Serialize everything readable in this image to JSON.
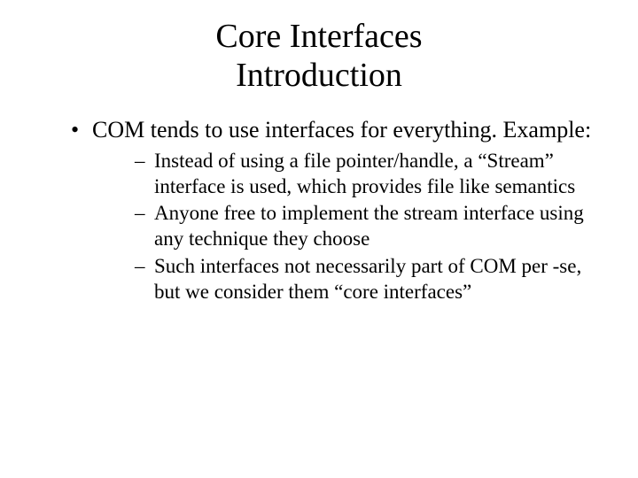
{
  "title_line1": "Core Interfaces",
  "title_line2": "Introduction",
  "bullets": [
    {
      "text": "COM tends to use interfaces for everything. Example:",
      "subs": [
        "Instead of using a file pointer/handle, a “Stream” interface is used, which provides file like semantics",
        "Anyone free to implement the stream interface using any technique they choose",
        "Such interfaces not necessarily part of COM per -se, but we consider them “core interfaces”"
      ]
    }
  ]
}
